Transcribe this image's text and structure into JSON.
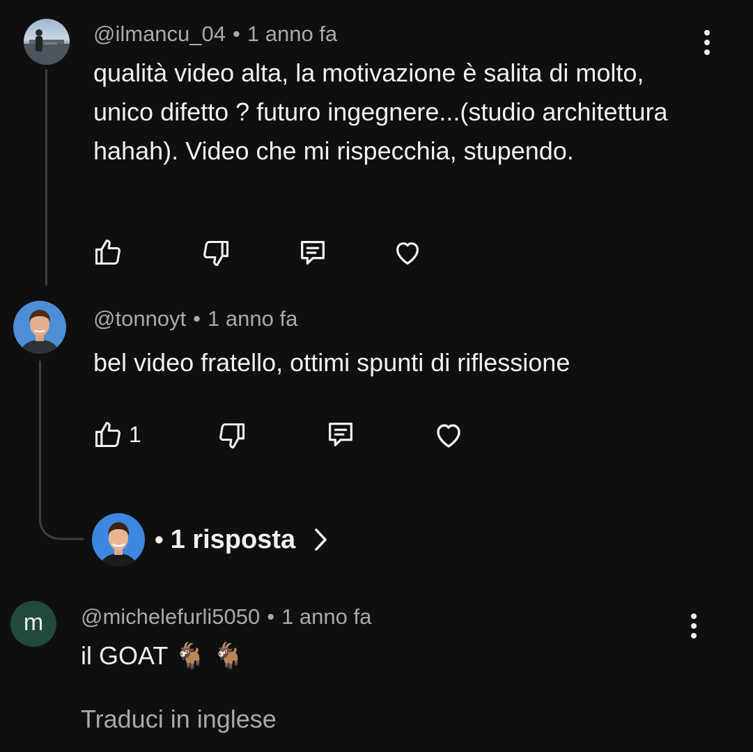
{
  "comments": [
    {
      "author": "@ilmancu_04",
      "separator": "•",
      "time": "1 anno fa",
      "text": "qualità video alta, la motivazione è salita di molto, unico difetto ? futuro ingegnere...(studio architettura hahah). Video che mi rispecchia, stupendo.",
      "like_count": ""
    },
    {
      "author": "@tonnoyt",
      "separator": "•",
      "time": "1 anno fa",
      "text": "bel video fratello, ottimi spunti di riflessione",
      "like_count": "1"
    },
    {
      "author": "@michelefurli5050",
      "separator": "•",
      "time": "1 anno fa",
      "text": "il GOAT 🐐 🐐",
      "avatar_letter": "m",
      "translate": "Traduci in inglese"
    }
  ],
  "replies": {
    "bullet": "•",
    "label": "1 risposta"
  },
  "icons": [
    "like-icon",
    "dislike-icon",
    "reply-icon",
    "heart-icon",
    "chevron-right-icon",
    "more-vert-icon"
  ],
  "colors": {
    "background": "#0f0f0f",
    "text": "#f1f1f1",
    "meta": "#aaaaaa",
    "thread_line": "#3f3f3f",
    "letter_avatar": "#1f4a3c"
  }
}
